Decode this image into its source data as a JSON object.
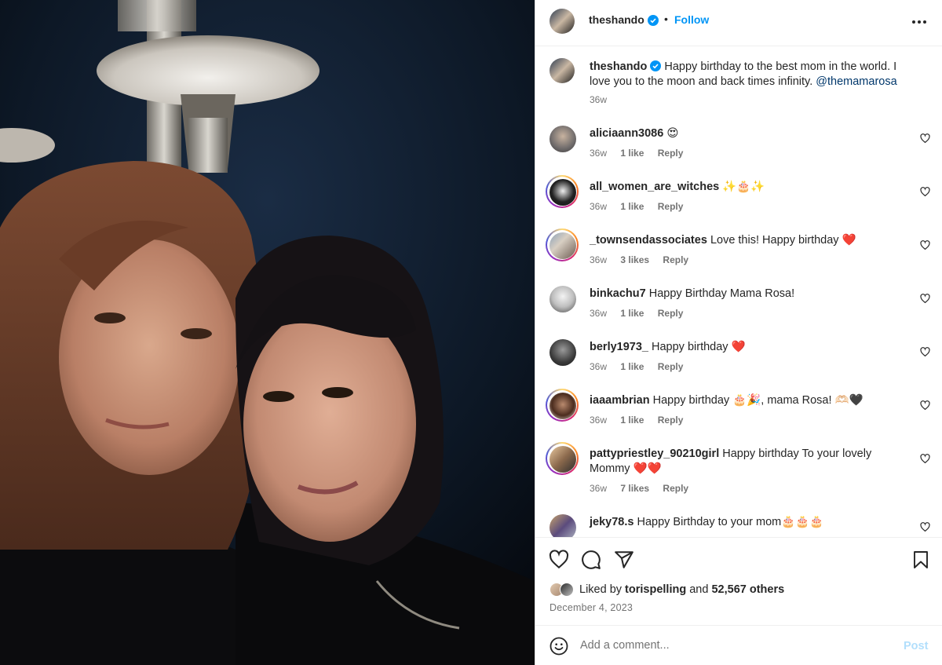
{
  "post": {
    "author": "theshando",
    "follow_label": "Follow",
    "dot": "•"
  },
  "caption": {
    "username": "theshando",
    "text": "Happy birthday to the best mom in the world. I love you to the moon and back times infinity.",
    "mention": "@themamarosa",
    "time": "36w"
  },
  "comments": [
    {
      "username": "aliciaann3086",
      "text": "😍",
      "time": "36w",
      "likes": "1 like",
      "reply": "Reply"
    },
    {
      "username": "all_women_are_witches",
      "text": "✨🎂✨",
      "time": "36w",
      "likes": "1 like",
      "reply": "Reply"
    },
    {
      "username": "_townsendassociates",
      "text": "Love this! Happy birthday ❤️",
      "time": "36w",
      "likes": "3 likes",
      "reply": "Reply"
    },
    {
      "username": "binkachu7",
      "text": "Happy Birthday Mama Rosa!",
      "time": "36w",
      "likes": "1 like",
      "reply": "Reply"
    },
    {
      "username": "berly1973_",
      "text": "Happy birthday ❤️",
      "time": "36w",
      "likes": "1 like",
      "reply": "Reply"
    },
    {
      "username": "iaaambrian",
      "text": "Happy birthday 🎂🎉, mama Rosa! 🫶🏻🖤",
      "time": "36w",
      "likes": "1 like",
      "reply": "Reply"
    },
    {
      "username": "pattypriestley_90210girl",
      "text": "Happy birthday To your lovely Mommy ❤️❤️",
      "time": "36w",
      "likes": "7 likes",
      "reply": "Reply"
    },
    {
      "username": "jeky78.s",
      "text": "Happy Birthday to your mom🎂🎂🎂",
      "time": "",
      "likes": "",
      "reply": ""
    }
  ],
  "likes": {
    "prefix": "Liked by",
    "user": "torispelling",
    "and": "and",
    "others": "52,567 others"
  },
  "date": "December 4, 2023",
  "add_comment": {
    "placeholder": "Add a comment...",
    "post_label": "Post"
  },
  "colors": {
    "link": "#0095f6",
    "mention": "#00376b",
    "muted": "#737373",
    "verified": "#0095f6"
  }
}
